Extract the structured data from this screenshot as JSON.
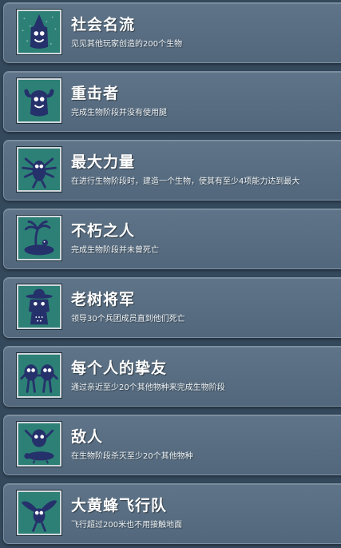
{
  "achievements": [
    {
      "title": "社会名流",
      "description": "见见其他玩家创造的200个生物",
      "icon": "creature-party-hat-icon"
    },
    {
      "title": "重击者",
      "description": "完成生物阶段并没有使用腿",
      "icon": "creature-flexing-arms-icon"
    },
    {
      "title": "最大力量",
      "description": "在进行生物阶段时，建造一个生物，使其有至少4项能力达到最大",
      "icon": "creature-many-arms-icon"
    },
    {
      "title": "不朽之人",
      "description": "完成生物阶段并未曾死亡",
      "icon": "island-palm-tree-icon"
    },
    {
      "title": "老树将军",
      "description": "领导30个兵团成员直到他们死亡",
      "icon": "cowboy-creature-icon"
    },
    {
      "title": "每个人的挚友",
      "description": "通过亲近至少20个其他物种来完成生物阶段",
      "icon": "two-creatures-friends-icon"
    },
    {
      "title": "敌人",
      "description": "在生物阶段杀灭至少20个其他物种",
      "icon": "creature-over-defeated-enemy-icon"
    },
    {
      "title": "大黄蜂飞行队",
      "description": "飞行超过200米也不用接触地面",
      "icon": "flying-creature-icon"
    }
  ],
  "colors": {
    "background": "#34495c",
    "card": "#5a6f83",
    "icon_bg": "#2d8076",
    "creature": "#25316b"
  }
}
